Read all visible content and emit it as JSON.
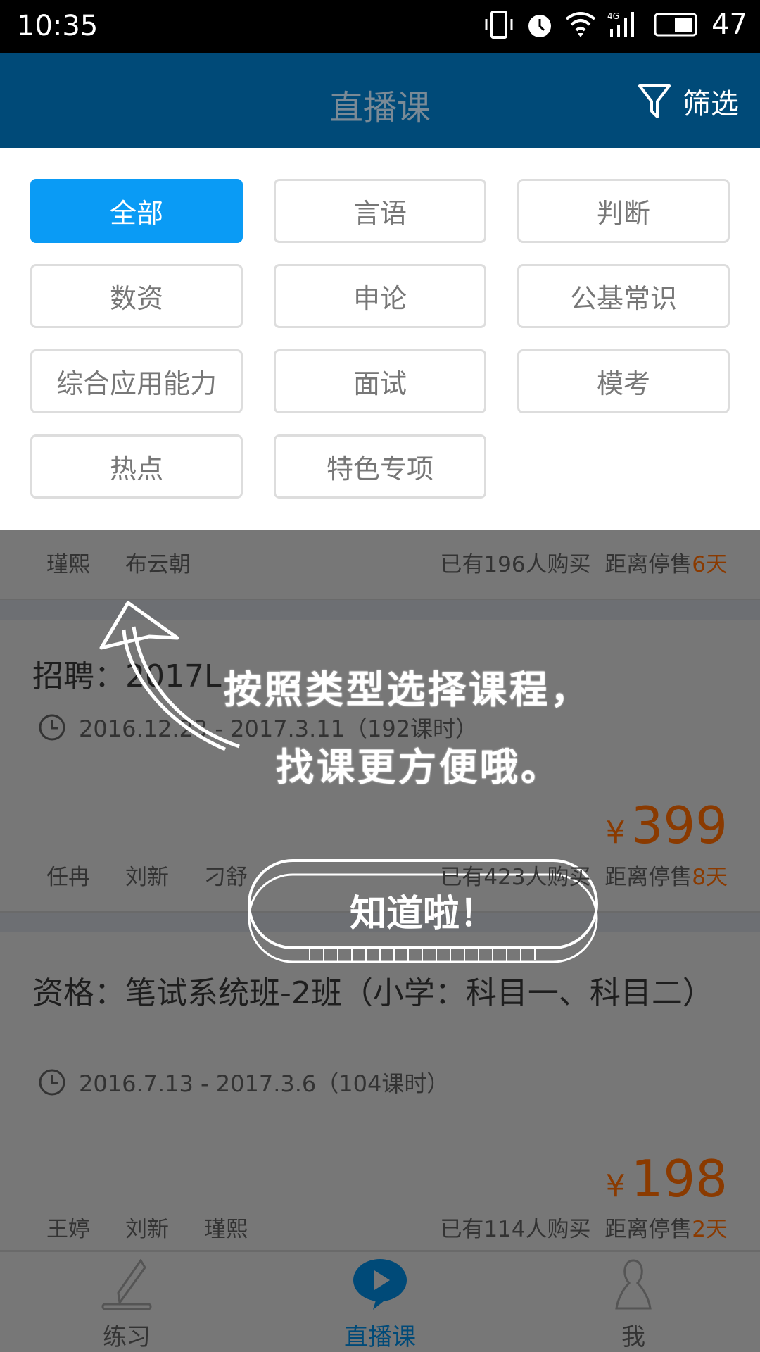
{
  "status_bar": {
    "time": "10:35",
    "battery": "47",
    "network": "4G"
  },
  "header": {
    "title": "直播课",
    "filter_label": "筛选"
  },
  "categories": [
    {
      "label": "全部",
      "selected": true
    },
    {
      "label": "言语"
    },
    {
      "label": "判断"
    },
    {
      "label": "数资"
    },
    {
      "label": "申论"
    },
    {
      "label": "公基常识"
    },
    {
      "label": "综合应用能力"
    },
    {
      "label": "面试"
    },
    {
      "label": "模考"
    },
    {
      "label": "热点"
    },
    {
      "label": "特色专项"
    }
  ],
  "courses": [
    {
      "teachers": [
        "瑾熙",
        "布云朝"
      ],
      "buyers": "已有196人购买",
      "stop_prefix": "距离停售",
      "stop_days": "6天"
    },
    {
      "title": "招聘：2017L",
      "date": "2016.12.23 - 2017.3.11（192课时）",
      "currency": "¥",
      "price": "399",
      "teachers": [
        "任冉",
        "刘新",
        "刁舒"
      ],
      "buyers": "已有423人购买",
      "stop_prefix": "距离停售",
      "stop_days": "8天"
    },
    {
      "title": "资格：笔试系统班-2班（小学：科目一、科目二）",
      "date": "2016.7.13 - 2017.3.6（104课时）",
      "currency": "¥",
      "price": "198",
      "teachers": [
        "王婷",
        "刘新",
        "瑾熙"
      ],
      "buyers": "已有114人购买",
      "stop_prefix": "距离停售",
      "stop_days": "2天"
    }
  ],
  "guide": {
    "line1": "按照类型选择课程，",
    "line2": "找课更方便哦。",
    "button": "知道啦！"
  },
  "bottom_nav": [
    {
      "label": "练习",
      "icon": "pencil-icon"
    },
    {
      "label": "直播课",
      "icon": "play-bubble-icon",
      "active": true
    },
    {
      "label": "我",
      "icon": "person-icon"
    }
  ],
  "colors": {
    "header": "#004a78",
    "accent": "#0a9bf5",
    "price": "#8a3a00"
  }
}
